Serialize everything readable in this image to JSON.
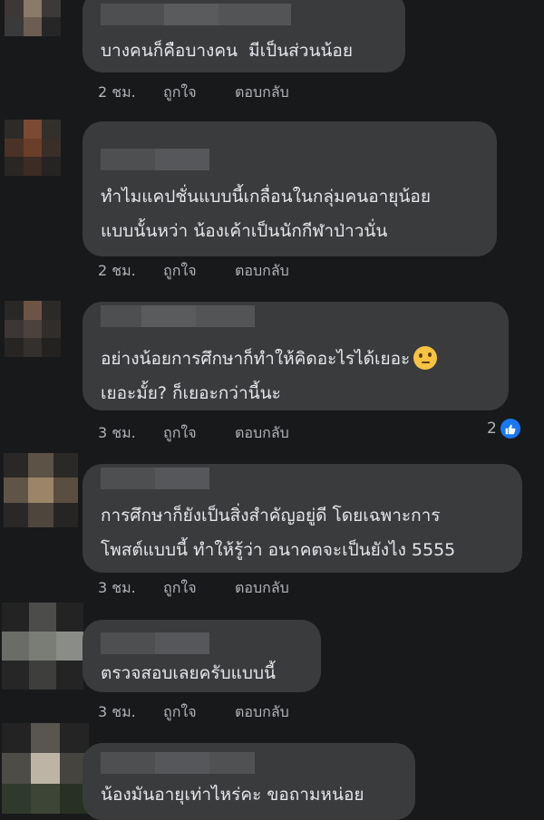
{
  "comments": [
    {
      "text_lines": [
        "บางคนก็คือบางคน  มีเป็นส่วนน้อย"
      ],
      "time": "2 ชม.",
      "like_label": "ถูกใจ",
      "reply_label": "ตอบกลับ"
    },
    {
      "text_lines": [
        "ทำไมแคปชั่นแบบนี้เกลื่อนในกลุ่มคนอายุน้อย",
        "แบบนั้นหว่า น้องเค้าเป็นนักกีฬาป่าวนั่น"
      ],
      "time": "2 ชม.",
      "like_label": "ถูกใจ",
      "reply_label": "ตอบกลับ"
    },
    {
      "text_lines": [
        "อย่างน้อยการศึกษาก็ทำให้คิดอะไรได้เยอะ",
        "เยอะมั้ย? ก็เยอะกว่านี้นะ"
      ],
      "emoji": "thinking-face",
      "time": "3 ชม.",
      "like_label": "ถูกใจ",
      "reply_label": "ตอบกลับ",
      "reaction_count": "2"
    },
    {
      "text_lines": [
        "การศึกษาก็ยังเป็นสิ่งสำคัญอยู่ดี โดยเฉพาะการ",
        "โพสต์แบบนี้ ทำให้รู้ว่า อนาคตจะเป็นยังไง 5555"
      ],
      "time": "3 ชม.",
      "like_label": "ถูกใจ",
      "reply_label": "ตอบกลับ"
    },
    {
      "text_lines": [
        "ตรวจสอบเลยครับแบบนี้"
      ],
      "time": "3 ชม.",
      "like_label": "ถูกใจ",
      "reply_label": "ตอบกลับ"
    },
    {
      "text_lines": [
        "น้องมันอายุเท่าไหร่คะ ขอถามหน่อย"
      ]
    }
  ],
  "colors": {
    "background": "#18191a",
    "bubble": "#3a3b3c",
    "text": "#e4e6eb",
    "secondary_text": "#b0b3b8",
    "like_badge": "#1877f2"
  },
  "icons": {
    "reaction": "like-thumb-icon",
    "emoji": "thinking-face-icon"
  }
}
